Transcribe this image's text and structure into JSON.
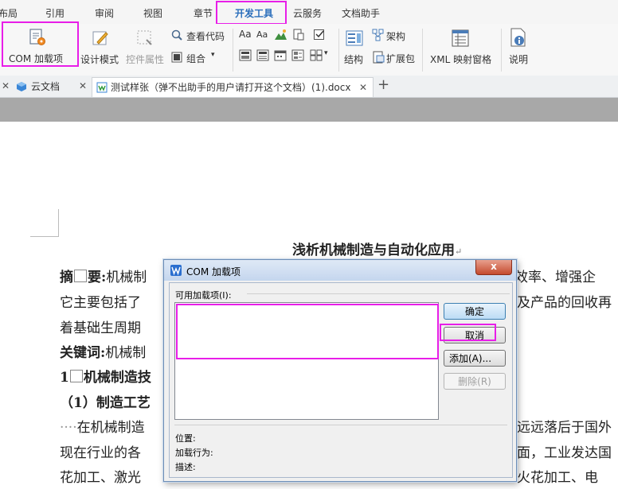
{
  "menu": {
    "tabs": [
      "布局",
      "引用",
      "审阅",
      "视图",
      "章节",
      "开发工具",
      "云服务",
      "文档助手"
    ],
    "active_tab": "开发工具"
  },
  "ribbon": {
    "com_addins": "COM 加载项",
    "design_mode": "设计模式",
    "control_props": "控件属性",
    "view_code": "查看代码",
    "combine": "组合",
    "architecture": "架构",
    "structure": "结构",
    "expansion_pack": "扩展包",
    "xml_pane": "XML 映射窗格",
    "help": "说明"
  },
  "doc_tabs": {
    "cloud": "云文档",
    "file": "测试样张（弹不出助手的用户请打开这个文档）(1).docx",
    "new_tab": "+"
  },
  "document": {
    "title": "浅析机械制造与自动化应用",
    "abstract_label": "摘",
    "abstract_label2": "要:",
    "line1_a": "机械制",
    "line1_b": "升效率、增强企",
    "line2_a": "它主要包括了",
    "line2_b": "及产品的回收再",
    "line3": "着基础生周期",
    "keywords_label": "关键词:",
    "keywords_a": "机械制",
    "heading1_num": "1",
    "heading1": "机械制造技",
    "sub1": "（1）制造工艺",
    "para_dots": "····",
    "para_a": "在机械制造",
    "para_b": "远远落后于国外",
    "para2_a": "现在行业的各",
    "para2_b": "面，工业发达国",
    "para3_a": "花加工、激光",
    "para3_b": "火花加工、电",
    "title_mark": "↵"
  },
  "dialog": {
    "title": "COM 加载项",
    "available_label": "可用加载项(I):",
    "ok": "确定",
    "cancel": "取消",
    "add": "添加(A)...",
    "remove": "删除(R)",
    "location_label": "位置:",
    "load_behavior_label": "加载行为:",
    "description_label": "描述:",
    "close": "x"
  },
  "colors": {
    "highlight": "#e81ee8",
    "accent": "#2a6ebb"
  }
}
